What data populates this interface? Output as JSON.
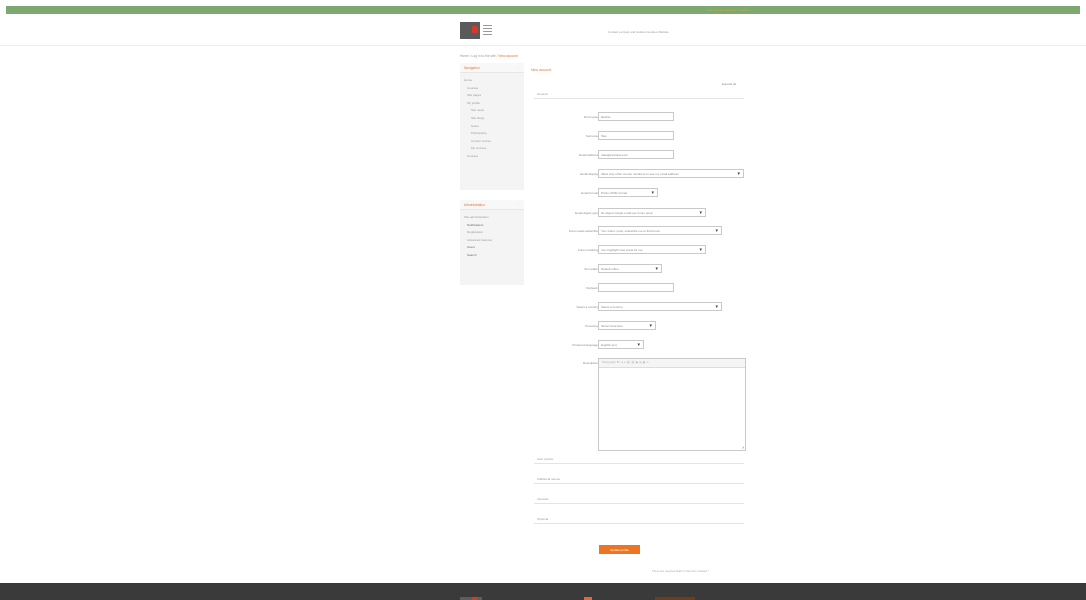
{
  "topbar": {
    "login_text": "You are not logged in. (Log in)"
  },
  "header": {
    "links_text": "Contact us   Help and Guides   Cookies   Website"
  },
  "breadcrumb": {
    "prefix": "Home  /  Log in to the site  /  ",
    "current": "New account"
  },
  "navigation_block": {
    "title": "Navigation",
    "toggle": "–",
    "items": [
      {
        "label": "Home",
        "level": 1
      },
      {
        "label": "Courses",
        "level": 2
      },
      {
        "label": "Site pages",
        "level": 2
      },
      {
        "label": "My profile",
        "level": 2
      },
      {
        "label": "Site news",
        "level": 3
      },
      {
        "label": "Site blogs",
        "level": 3
      },
      {
        "label": "Notes",
        "level": 3
      },
      {
        "label": "Participants",
        "level": 3
      },
      {
        "label": "Current course",
        "level": 3
      },
      {
        "label": "My courses",
        "level": 3
      },
      {
        "label": "Courses",
        "level": 2
      }
    ]
  },
  "administration_block": {
    "title": "Administration",
    "toggle": "–",
    "items": [
      {
        "label": "Site administration",
        "level": 1
      },
      {
        "label": "Notifications",
        "level": 2,
        "dark": true
      },
      {
        "label": "Registration",
        "level": 2
      },
      {
        "label": "Advanced features",
        "level": 2
      },
      {
        "label": "Users",
        "level": 2,
        "dark": true
      },
      {
        "label": "Search",
        "level": 2,
        "dark": true
      }
    ]
  },
  "page_title": "New account",
  "expand_all": "Expand all",
  "general_section": "General",
  "form_fields": [
    {
      "label": "First name",
      "value": "Rachel",
      "type": "text"
    },
    {
      "label": "Surname",
      "value": "Tate",
      "type": "text"
    },
    {
      "label": "Email address",
      "value": "rtate@example.com",
      "type": "text"
    },
    {
      "label": "Email display",
      "value": "Allow only other course members to see my email address",
      "type": "select"
    },
    {
      "label": "Email format",
      "value": "Pretty HTML format",
      "type": "select"
    },
    {
      "label": "Email digest type",
      "value": "No digest (single email per forum post)",
      "type": "select"
    },
    {
      "label": "Forum auto-subscribe",
      "value": "Yes: when I post, subscribe me to that forum",
      "type": "select"
    },
    {
      "label": "Forum tracking",
      "value": "Yes: highlight new posts for me",
      "type": "select"
    },
    {
      "label": "Text editor",
      "value": "Default editor",
      "type": "select"
    },
    {
      "label": "City/town",
      "value": "",
      "type": "text"
    },
    {
      "label": "Select a country",
      "value": "Select a country...",
      "type": "select"
    },
    {
      "label": "Timezone",
      "value": "Server timezone",
      "type": "select"
    },
    {
      "label": "Preferred language",
      "value": "English (en)",
      "type": "select"
    }
  ],
  "description_field": {
    "label": "Description",
    "toolbar": "Paragraph  B  I  ≡  ≡  ⛓  ⛓  ▣  ▤  ▦  ▭"
  },
  "collapsed_sections": [
    "User picture",
    "Additional names",
    "Interests",
    "Optional"
  ],
  "submit_label": "Update profile",
  "required_note": "There are required fields in this form marked *.",
  "theme": {
    "accent": "#ef7422",
    "topbar": "#7da870",
    "footer": "#3a3a3a"
  }
}
